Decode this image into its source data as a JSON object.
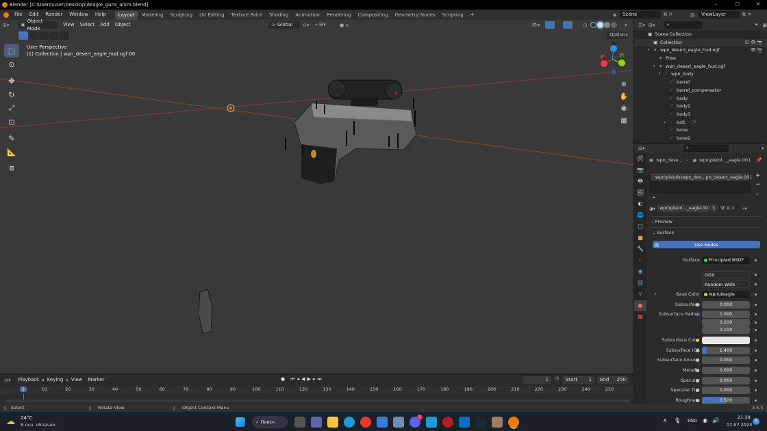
{
  "titlebar": {
    "title": "Blender [C:\\Users\\user\\Desktop\\deagle_guns_anim.blend]",
    "minimize": "–",
    "maximize": "☐",
    "close": "✕"
  },
  "menu": [
    "File",
    "Edit",
    "Render",
    "Window",
    "Help"
  ],
  "workspaces": [
    "Layout",
    "Modeling",
    "Sculpting",
    "UV Editing",
    "Texture Paint",
    "Shading",
    "Animation",
    "Rendering",
    "Compositing",
    "Geometry Nodes",
    "Scripting"
  ],
  "scene": {
    "scene_name": "Scene",
    "view_layer": "ViewLayer"
  },
  "viewport": {
    "mode": "Object Mode",
    "menus": [
      "View",
      "Select",
      "Add",
      "Object"
    ],
    "orientation": "Global",
    "options": "Options",
    "perspective": "User Perspective",
    "collection_line": "(1) Collection | wpn_desert_eagle_hud.ogf 00",
    "gizmo_axes": [
      "X",
      "Y",
      "Z"
    ]
  },
  "outliner": {
    "rows": [
      {
        "label": "Scene Collection",
        "indent": 0,
        "icon": "collection"
      },
      {
        "label": "Collection",
        "indent": 1,
        "icon": "collection"
      },
      {
        "label": "wpn_desert_eagle_hud.ogf",
        "indent": 1,
        "icon": "armature-obj"
      },
      {
        "label": "Pose",
        "indent": 2,
        "icon": "pose"
      },
      {
        "label": "wpn_desert_eagle_hud.ogf",
        "indent": 2,
        "icon": "armature"
      },
      {
        "label": "wpn_body",
        "indent": 3,
        "icon": "bone"
      },
      {
        "label": "barrel",
        "indent": 4,
        "icon": "bone"
      },
      {
        "label": "barrel_compensator",
        "indent": 4,
        "icon": "bone"
      },
      {
        "label": "body",
        "indent": 4,
        "icon": "bone"
      },
      {
        "label": "body2",
        "indent": 4,
        "icon": "bone"
      },
      {
        "label": "body3",
        "indent": 4,
        "icon": "bone"
      },
      {
        "label": "bolt",
        "indent": 4,
        "icon": "bone",
        "badge": "2"
      },
      {
        "label": "bone",
        "indent": 4,
        "icon": "bone"
      },
      {
        "label": "bone2",
        "indent": 4,
        "icon": "bone"
      }
    ]
  },
  "properties": {
    "breadcrumb_obj": "wpn_dese...",
    "breadcrumb_mat": "wpn\\pistol..._eagle.001",
    "slot": "wpn\\pistols\\wpn_des...pn_desert_eagle.001",
    "material_name": "wpn\\pistol..._eagle.001",
    "users": "3",
    "preview": "Preview",
    "surface": "Surface",
    "use_nodes": "Use Nodes",
    "fields": [
      {
        "label": "Surface",
        "value": "Principled BSDF",
        "kind": "link"
      },
      {
        "label": "",
        "value": "GGX",
        "kind": "select"
      },
      {
        "label": "",
        "value": "Random Walk",
        "kind": "select"
      },
      {
        "label": "Base Color",
        "value": "wpn\\deagle",
        "kind": "link"
      },
      {
        "label": "Subsurface",
        "value": "0.000",
        "kind": "num"
      },
      {
        "label": "Subsurface Radius",
        "value": "1.000",
        "kind": "num"
      },
      {
        "label": "",
        "value": "0.200",
        "kind": "num"
      },
      {
        "label": "",
        "value": "0.100",
        "kind": "num"
      },
      {
        "label": "Subsurface Color",
        "value": "",
        "kind": "color"
      },
      {
        "label": "Subsurface IOR",
        "value": "1.400",
        "kind": "num"
      },
      {
        "label": "Subsurface Aniso...",
        "value": "0.000",
        "kind": "num"
      },
      {
        "label": "Metallic",
        "value": "0.000",
        "kind": "num"
      },
      {
        "label": "Specular",
        "value": "0.000",
        "kind": "num"
      },
      {
        "label": "Specular Tint",
        "value": "0.000",
        "kind": "num"
      },
      {
        "label": "Roughness",
        "value": "0.500",
        "kind": "num"
      }
    ]
  },
  "timeline": {
    "menus": [
      "Playback",
      "Keying",
      "View",
      "Marker"
    ],
    "current_frame": "1",
    "start_label": "Start",
    "start": "1",
    "end_label": "End",
    "end": "250",
    "ruler": [
      "1",
      "10",
      "20",
      "30",
      "40",
      "50",
      "60",
      "70",
      "80",
      "90",
      "100",
      "110",
      "120",
      "130",
      "140",
      "150",
      "160",
      "170",
      "180",
      "190",
      "200",
      "210",
      "220",
      "230",
      "240",
      "250"
    ]
  },
  "statusbar": {
    "select": "Select",
    "rotate": "Rotate View",
    "context": "Object Context Menu",
    "version": "3.5.0"
  },
  "taskbar": {
    "temp": "24°C",
    "weather": "В осн. облачно",
    "search": "Поиск",
    "lang": "ENG",
    "time": "21:39",
    "date": "07.07.2023",
    "notif": "5",
    "badge": "1"
  },
  "colors": {
    "accent": "#4772b3",
    "active_tool": "#4b5d7a",
    "x_axis": "#ff3352",
    "y_axis": "#8bdc00",
    "z_axis": "#2890ff"
  }
}
